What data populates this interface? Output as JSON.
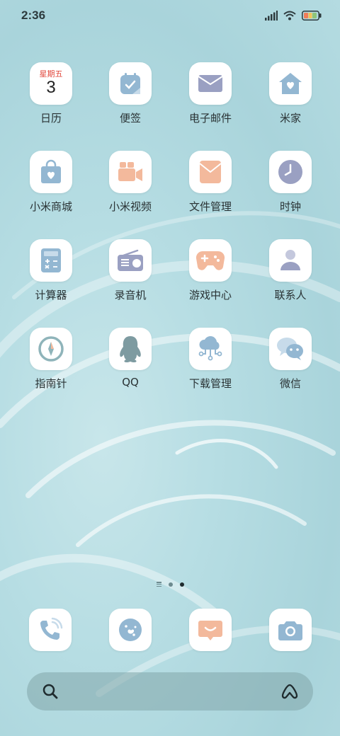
{
  "status_bar": {
    "time": "2:36"
  },
  "apps": [
    {
      "label": "日历",
      "cal_day": "星期五",
      "cal_date": "3"
    },
    {
      "label": "便签"
    },
    {
      "label": "电子邮件"
    },
    {
      "label": "米家"
    },
    {
      "label": "小米商城"
    },
    {
      "label": "小米视频"
    },
    {
      "label": "文件管理"
    },
    {
      "label": "时钟"
    },
    {
      "label": "计算器"
    },
    {
      "label": "录音机"
    },
    {
      "label": "游戏中心"
    },
    {
      "label": "联系人"
    },
    {
      "label": "指南针"
    },
    {
      "label": "QQ"
    },
    {
      "label": "下载管理"
    },
    {
      "label": "微信"
    }
  ],
  "page_indicator": {
    "pages": 2,
    "current": 2
  },
  "dock": [
    "phone-icon",
    "browser-icon",
    "messages-icon",
    "camera-icon"
  ],
  "colors": {
    "pastel_blue": "#93b7d2",
    "pastel_orange": "#f3b99c",
    "pastel_purple": "#9aa0c2",
    "calendar_red": "#e0453a"
  }
}
